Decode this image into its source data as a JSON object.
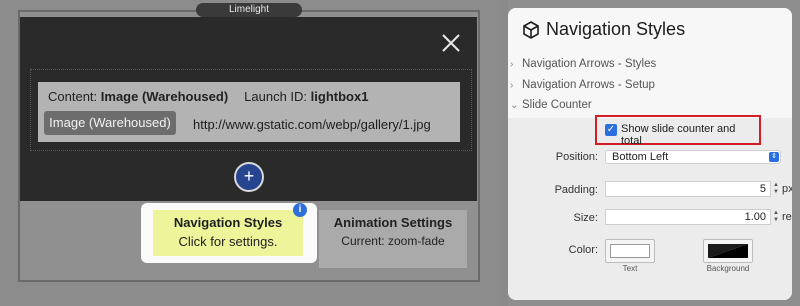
{
  "stack": {
    "tag": "Limelight"
  },
  "lightbox": {
    "content_prefix": "Content:",
    "content_value": "Image (Warehoused)",
    "launch_prefix": "Launch ID:",
    "launch_value": "lightbox1",
    "image_chip": "Image (Warehoused)",
    "image_url": "http://www.gstatic.com/webp/gallery/1.jpg",
    "add_symbol": "+",
    "close_icon": "close-icon"
  },
  "cards": {
    "nav_title": "Navigation Styles",
    "nav_sub": "Click for settings.",
    "info_symbol": "i",
    "anim_title": "Animation Settings",
    "anim_sub": "Current: zoom-fade"
  },
  "panel": {
    "title": "Navigation Styles",
    "icon": "cube-icon",
    "sections": [
      {
        "label": "Navigation Arrows - Styles",
        "chevron": "›"
      },
      {
        "label": "Navigation Arrows - Setup",
        "chevron": "›"
      },
      {
        "label": "Slide Counter",
        "chevron": "⌄"
      }
    ],
    "checkbox_label": "Show slide counter and total",
    "checkbox_checked": true,
    "position_label": "Position:",
    "position_value": "Bottom Left",
    "padding_label": "Padding:",
    "padding_value": "5",
    "padding_unit": "px",
    "size_label": "Size:",
    "size_value": "1.00",
    "size_unit": "rem",
    "color_label": "Color:",
    "text_caption": "Text",
    "background_caption": "Background",
    "colors": {
      "text_swatch": "#ffffff",
      "background_swatch": "#000000",
      "checkbox": "#2a6fe0",
      "highlight": "#d21f26"
    }
  }
}
